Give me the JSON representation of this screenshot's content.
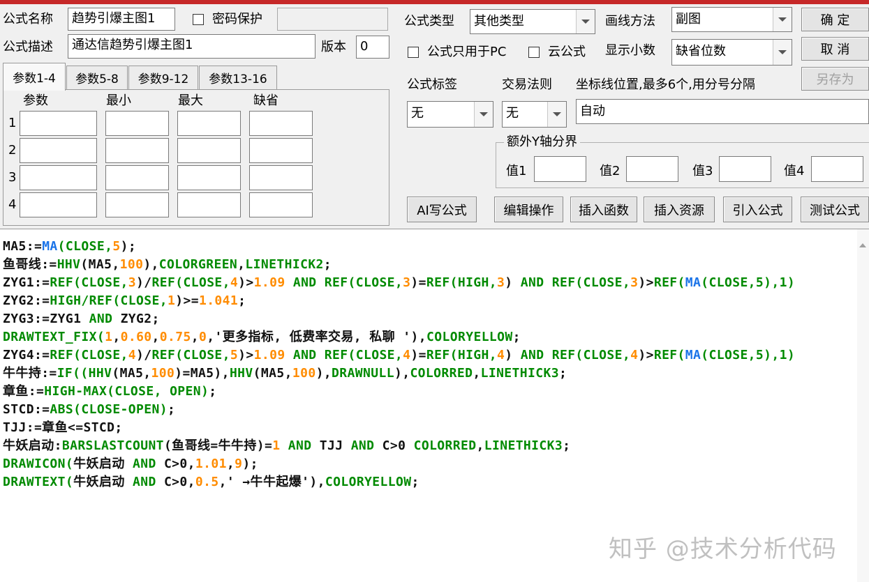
{
  "colors": {
    "accent_bar": "#c62828",
    "code_default": "#111111",
    "code_keyword": "#008a00",
    "code_number": "#ff8c00",
    "code_function_blue": "#1a73e8"
  },
  "header": {
    "formula_name_label": "公式名称",
    "formula_name_value": "趋势引爆主图1",
    "password_label": "密码保护",
    "formula_desc_label": "公式描述",
    "formula_desc_value": "通达信趋势引爆主图1",
    "version_label": "版本",
    "version_value": "0",
    "type_label": "公式类型",
    "type_value": "其他类型",
    "draw_method_label": "画线方法",
    "draw_method_value": "副图",
    "pc_only_label": "公式只用于PC",
    "cloud_label": "云公式",
    "decimals_label": "显示小数",
    "decimals_value": "缺省位数",
    "tag_label": "公式标签",
    "trade_rule_label": "交易法则",
    "axis_label": "坐标线位置,最多6个,用分号分隔",
    "tag_value": "无",
    "trade_rule_value": "无",
    "axis_value": "自动",
    "extra_y_title": "额外Y轴分界",
    "val1_label": "值1",
    "val2_label": "值2",
    "val3_label": "值3",
    "val4_label": "值4"
  },
  "buttons": {
    "ok": "确  定",
    "cancel": "取  消",
    "save_as": "另存为",
    "ai_write": "AI写公式",
    "edit_ops": "编辑操作",
    "insert_func": "插入函数",
    "insert_resource": "插入资源",
    "import_formula": "引入公式",
    "test_formula": "测试公式"
  },
  "params": {
    "tabs": [
      "参数1-4",
      "参数5-8",
      "参数9-12",
      "参数13-16"
    ],
    "columns": [
      "参数",
      "最小",
      "最大",
      "缺省"
    ],
    "rows": [
      "1",
      "2",
      "3",
      "4"
    ]
  },
  "code_lines": [
    [
      [
        "MA5:=",
        "d"
      ],
      [
        "MA",
        "b"
      ],
      [
        "(",
        "g"
      ],
      [
        "CLOSE",
        "g"
      ],
      [
        ",",
        "g"
      ],
      [
        "5",
        "o"
      ],
      [
        ");",
        "d"
      ]
    ],
    [
      [
        "鱼哥线:=",
        "d"
      ],
      [
        "HHV",
        "g"
      ],
      [
        "(MA5,",
        "d"
      ],
      [
        "100",
        "o"
      ],
      [
        "),",
        "d"
      ],
      [
        "COLORGREEN",
        "g"
      ],
      [
        ",",
        "d"
      ],
      [
        "LINETHICK2",
        "g"
      ],
      [
        ";",
        "d"
      ]
    ],
    [
      [
        "ZYG1:=",
        "d"
      ],
      [
        "REF(CLOSE,",
        "g"
      ],
      [
        "3",
        "o"
      ],
      [
        ")/",
        "d"
      ],
      [
        "REF(CLOSE,",
        "g"
      ],
      [
        "4",
        "o"
      ],
      [
        ")>",
        "d"
      ],
      [
        "1.09",
        "o"
      ],
      [
        " AND ",
        "g"
      ],
      [
        "REF(CLOSE,",
        "g"
      ],
      [
        "3",
        "o"
      ],
      [
        ")=",
        "d"
      ],
      [
        "REF(HIGH,",
        "g"
      ],
      [
        "3",
        "o"
      ],
      [
        ") ",
        "d"
      ],
      [
        "AND ",
        "g"
      ],
      [
        "REF(CLOSE,",
        "g"
      ],
      [
        "3",
        "o"
      ],
      [
        ")>",
        "d"
      ],
      [
        "REF(",
        "g"
      ],
      [
        "MA",
        "b"
      ],
      [
        "(CLOSE,5),1)",
        "g"
      ]
    ],
    [
      [
        "ZYG2:=",
        "d"
      ],
      [
        "HIGH/",
        "g"
      ],
      [
        "REF(CLOSE,",
        "g"
      ],
      [
        "1",
        "o"
      ],
      [
        ")>=",
        "d"
      ],
      [
        "1.041",
        "o"
      ],
      [
        ";",
        "d"
      ]
    ],
    [
      [
        "ZYG3:=ZYG1 ",
        "d"
      ],
      [
        "AND",
        "g"
      ],
      [
        " ZYG2;",
        "d"
      ]
    ],
    [
      [
        "DRAWTEXT_FIX(",
        "g"
      ],
      [
        "1",
        "o"
      ],
      [
        ",",
        "d"
      ],
      [
        "0.60",
        "o"
      ],
      [
        ",",
        "d"
      ],
      [
        "0.75",
        "o"
      ],
      [
        ",",
        "d"
      ],
      [
        "0",
        "o"
      ],
      [
        ",'更多指标, 低费率交易, 私聊 '),",
        "d"
      ],
      [
        "COLORYELLOW",
        "g"
      ],
      [
        ";",
        "d"
      ]
    ],
    [
      [
        "ZYG4:=",
        "d"
      ],
      [
        "REF(CLOSE,",
        "g"
      ],
      [
        "4",
        "o"
      ],
      [
        ")/",
        "d"
      ],
      [
        "REF(CLOSE,",
        "g"
      ],
      [
        "5",
        "o"
      ],
      [
        ")>",
        "d"
      ],
      [
        "1.09",
        "o"
      ],
      [
        " AND ",
        "g"
      ],
      [
        "REF(CLOSE,",
        "g"
      ],
      [
        "4",
        "o"
      ],
      [
        ")=",
        "d"
      ],
      [
        "REF(HIGH,",
        "g"
      ],
      [
        "4",
        "o"
      ],
      [
        ") ",
        "d"
      ],
      [
        "AND ",
        "g"
      ],
      [
        "REF(CLOSE,",
        "g"
      ],
      [
        "4",
        "o"
      ],
      [
        ")>",
        "d"
      ],
      [
        "REF(",
        "g"
      ],
      [
        "MA",
        "b"
      ],
      [
        "(CLOSE,5),1)",
        "g"
      ]
    ],
    [
      [
        "牛牛持:=",
        "d"
      ],
      [
        "IF((",
        "g"
      ],
      [
        "HHV",
        "g"
      ],
      [
        "(MA5,",
        "d"
      ],
      [
        "100",
        "o"
      ],
      [
        ")=MA5),",
        "d"
      ],
      [
        "HHV",
        "g"
      ],
      [
        "(MA5,",
        "d"
      ],
      [
        "100",
        "o"
      ],
      [
        "),",
        "d"
      ],
      [
        "DRAWNULL",
        "g"
      ],
      [
        "),",
        "d"
      ],
      [
        "COLORRED",
        "g"
      ],
      [
        ",",
        "d"
      ],
      [
        "LINETHICK3",
        "g"
      ],
      [
        ";",
        "d"
      ]
    ],
    [
      [
        "章鱼:=",
        "d"
      ],
      [
        "HIGH-MAX(CLOSE, OPEN)",
        "g"
      ],
      [
        ";",
        "d"
      ]
    ],
    [
      [
        "STCD:=",
        "d"
      ],
      [
        "ABS(CLOSE-OPEN)",
        "g"
      ],
      [
        ";",
        "d"
      ]
    ],
    [
      [
        "TJJ:=章鱼<=STCD;",
        "d"
      ]
    ],
    [
      [
        "牛妖启动:",
        "d"
      ],
      [
        "BARSLASTCOUNT",
        "g"
      ],
      [
        "(鱼哥线=牛牛持)=",
        "d"
      ],
      [
        "1",
        "o"
      ],
      [
        " AND ",
        "g"
      ],
      [
        "TJJ ",
        "d"
      ],
      [
        "AND ",
        "g"
      ],
      [
        "C>0 ",
        "d"
      ],
      [
        "COLORRED",
        "g"
      ],
      [
        ",",
        "d"
      ],
      [
        "LINETHICK3",
        "g"
      ],
      [
        ";",
        "d"
      ]
    ],
    [
      [
        "DRAWICON(",
        "g"
      ],
      [
        "牛妖启动 ",
        "d"
      ],
      [
        "AND",
        "g"
      ],
      [
        " C>0,",
        "d"
      ],
      [
        "1.01",
        "o"
      ],
      [
        ",",
        "d"
      ],
      [
        "9",
        "o"
      ],
      [
        ");",
        "d"
      ]
    ],
    [
      [
        "DRAWTEXT(",
        "g"
      ],
      [
        "牛妖启动 ",
        "d"
      ],
      [
        "AND",
        "g"
      ],
      [
        " C>0,",
        "d"
      ],
      [
        "0.5",
        "o"
      ],
      [
        ",' →牛牛起爆'),",
        "d"
      ],
      [
        "COLORYELLOW",
        "g"
      ],
      [
        ";",
        "d"
      ]
    ]
  ],
  "watermark": "知乎 @技术分析代码"
}
